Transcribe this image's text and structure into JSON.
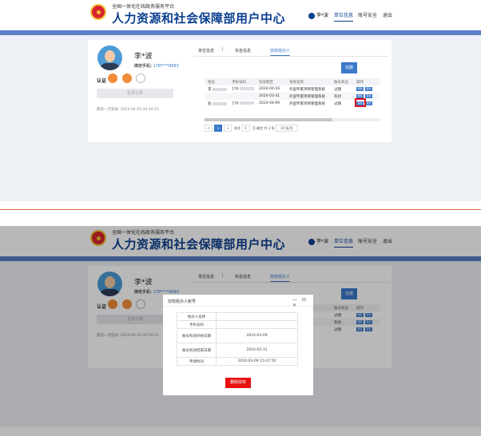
{
  "header": {
    "site_subtitle": "全国一体化在线政务服务平台",
    "site_title": "人力资源和社会保障部用户中心",
    "user_name": "李*波",
    "nav": [
      "单位信息",
      "账号安全",
      "退出"
    ],
    "active_nav": "单位信息"
  },
  "profile": {
    "name": "李*波",
    "phone_label": "绑定手机:",
    "phone_value": "178****8683",
    "cert_label": "认证",
    "login_button": "登录记录",
    "last_login": "最后一次登录: 2024-04-09 20:34:21"
  },
  "tabs": [
    "单位信息",
    "实名信息",
    "授权经办人"
  ],
  "active_tab": "授权经办人",
  "create_button": "创建",
  "table": {
    "headers": [
      "姓名",
      "手机号码",
      "有效期至",
      "系统名称",
      "账号状态",
      "操作"
    ],
    "rows": [
      {
        "name": "李",
        "phone": "176",
        "date": "2024-04-16",
        "system": "外国专家项目管理系统",
        "status": "过期",
        "actions": [
          "授权",
          "延长"
        ]
      },
      {
        "name": "",
        "phone": "",
        "date": "2024-03-31",
        "system": "外国专家项目管理系统",
        "status": "有效",
        "actions": [
          "删除",
          "延长"
        ]
      },
      {
        "name": "赵",
        "phone": "176",
        "date": "2024-04-09",
        "system": "外国专家项目管理系统",
        "status": "过期",
        "actions": [
          "授权",
          "延长"
        ]
      }
    ]
  },
  "pagination": {
    "prev": "<",
    "page": "1",
    "next": ">",
    "goto_label": "前往",
    "goto_value": "1",
    "page_suffix": "页",
    "confirm": "确定",
    "total": "共 3 条",
    "page_size": "10 条/页"
  },
  "dialog": {
    "title": "授权经办人账号",
    "controls": "— ⊡ ✕",
    "fields": [
      {
        "label": "经办人名称",
        "value": ""
      },
      {
        "label": "手机号码",
        "value": ""
      },
      {
        "label": "账号有效开始日期",
        "value": "2024-03-09"
      },
      {
        "label": "账号有效结束日期",
        "value": "2024-03-31"
      },
      {
        "label": "申请时间",
        "value": "2024-03-09 15:47:50"
      }
    ],
    "delete_button": "删除授权"
  },
  "colors": {
    "brand": "#0b3f8f",
    "bar": "#5b7fc4",
    "accent": "#3a78c9",
    "danger": "#e80f0f"
  }
}
